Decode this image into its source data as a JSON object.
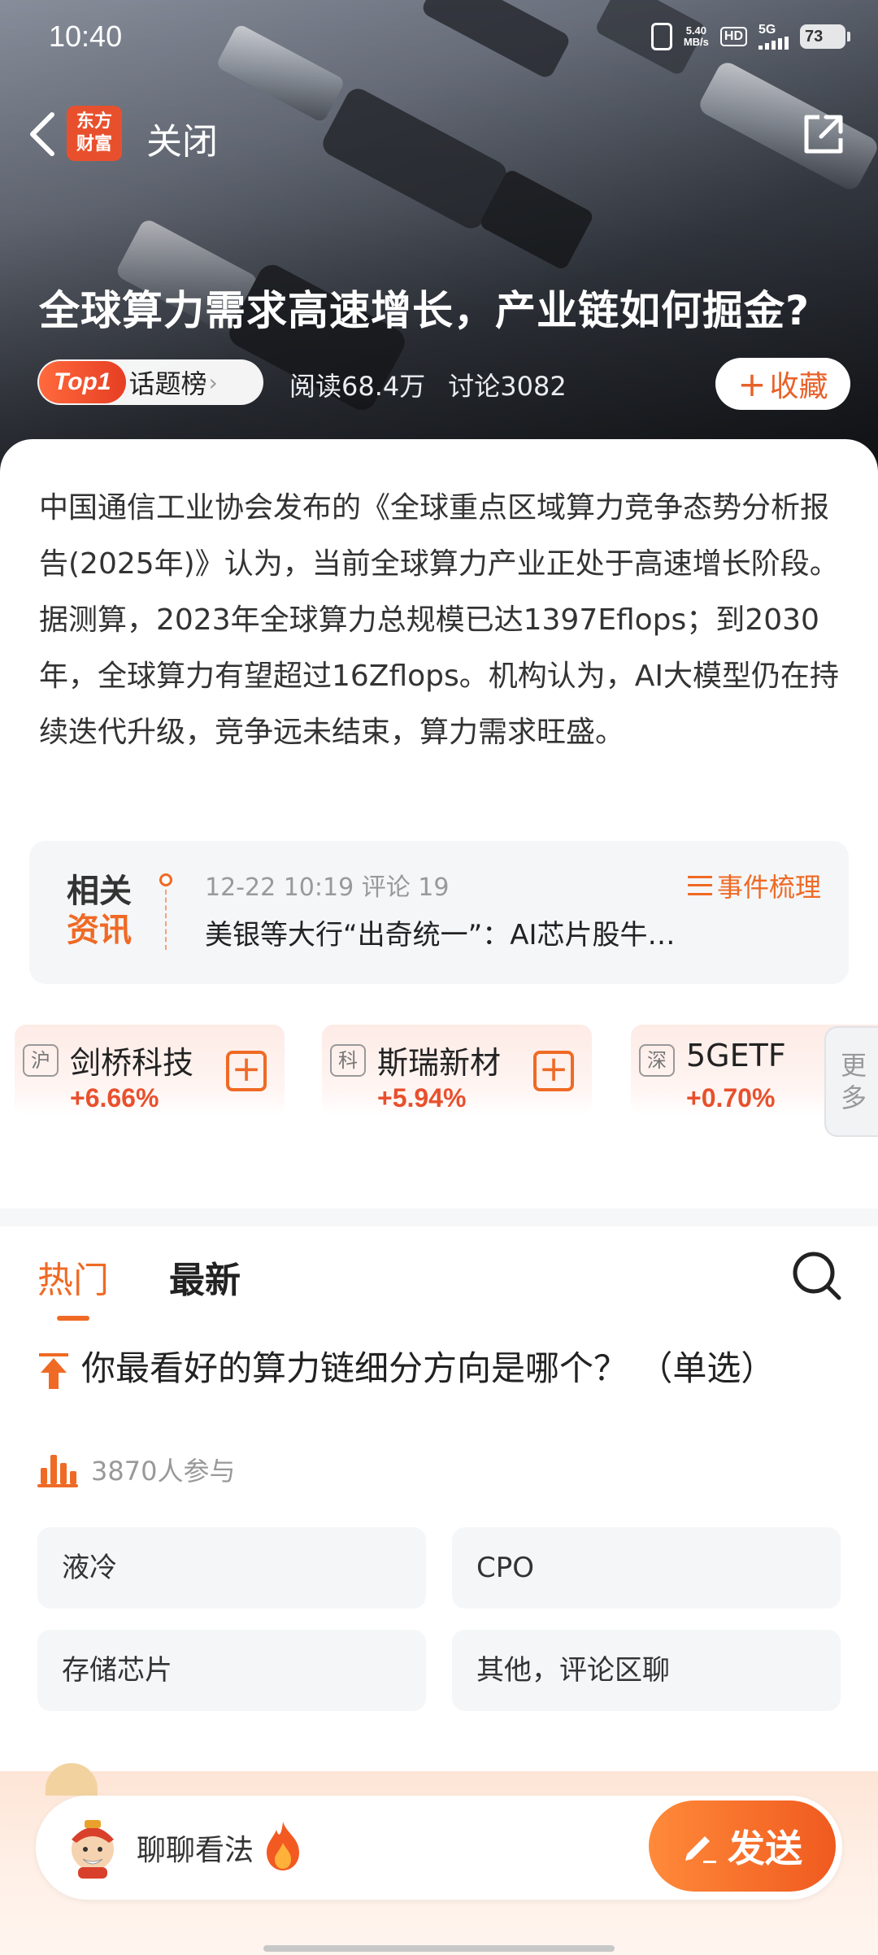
{
  "status_bar": {
    "time": "10:40",
    "net_speed_value": "5.40",
    "net_speed_unit": "MB/s",
    "hd": "HD",
    "network": "5G",
    "battery": "73"
  },
  "nav": {
    "logo_line1": "东方",
    "logo_line2": "财富",
    "close_label": "关闭"
  },
  "topic": {
    "title": "全球算力需求高速增长，产业链如何掘金?",
    "rank_badge": "Top1",
    "rank_label": "话题榜",
    "reads": "阅读68.4万",
    "discussions": "讨论3082",
    "collect_label": "收藏",
    "intro": "中国通信工业协会发布的《全球重点区域算力竞争态势分析报告(2025年)》认为，当前全球算力产业正处于高速增长阶段。据测算，2023年全球算力总规模已达1397Eflops；到2030年，全球算力有望超过16Zflops。机构认为，AI大模型仍在持续迭代升级，竞争远未结束，算力需求旺盛。"
  },
  "related_news": {
    "tag_line1": "相关",
    "tag_line2": "资讯",
    "meta": "12-22 10:19 评论 19",
    "headline": "美银等大行“出奇统一”：AI芯片股牛…",
    "event_label": "事件梳理"
  },
  "stocks": [
    {
      "exchange": "沪",
      "name": "剑桥科技",
      "change": "+6.66%"
    },
    {
      "exchange": "科",
      "name": "斯瑞新材",
      "change": "+5.94%"
    },
    {
      "exchange": "深",
      "name": "5GETF",
      "change": "+0.70%"
    }
  ],
  "more_label_1": "更",
  "more_label_2": "多",
  "tabs": {
    "hot": "热门",
    "latest": "最新"
  },
  "poll": {
    "question": "你最看好的算力链细分方向是哪个？ （单选）",
    "participants": "3870人参与",
    "options": [
      "液冷",
      "CPO",
      "存储芯片",
      "其他，评论区聊"
    ]
  },
  "composer": {
    "placeholder": "聊聊看法",
    "send_label": "发送"
  },
  "colors": {
    "accent": "#ef6a25",
    "up": "#e8502d"
  }
}
